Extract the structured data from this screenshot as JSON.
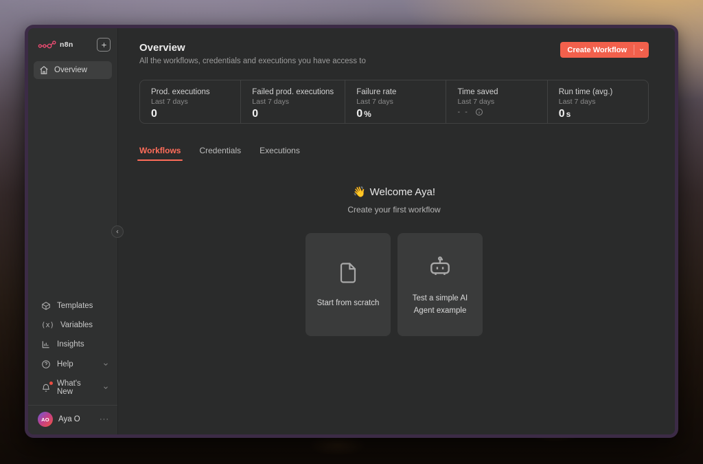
{
  "colors": {
    "accent": "#f2604c",
    "accent-light": "#ff6d5a",
    "logo": "#ea4b71",
    "badge": "#eb4d42"
  },
  "sidebar": {
    "logo_text": "n8n",
    "items": [
      {
        "label": "Overview",
        "icon": "home-icon"
      }
    ],
    "bottom_items": [
      {
        "label": "Templates",
        "icon": "package-icon"
      },
      {
        "label": "Variables",
        "icon": "variable-icon",
        "icon_glyph": "(x)"
      },
      {
        "label": "Insights",
        "icon": "bar-chart-icon"
      },
      {
        "label": "Help",
        "icon": "help-icon"
      },
      {
        "label": "What's New",
        "icon": "bell-icon"
      }
    ],
    "user": {
      "initials": "AO",
      "name": "Aya O",
      "menu_label": "···"
    }
  },
  "header": {
    "title": "Overview",
    "subtitle": "All the workflows, credentials and executions you have access to",
    "create_button_label": "Create Workflow"
  },
  "stats": {
    "cards": [
      {
        "label": "Prod. executions",
        "period": "Last 7 days",
        "value": "0",
        "unit": ""
      },
      {
        "label": "Failed prod. executions",
        "period": "Last 7 days",
        "value": "0",
        "unit": ""
      },
      {
        "label": "Failure rate",
        "period": "Last 7 days",
        "value": "0",
        "unit": "%"
      },
      {
        "label": "Time saved",
        "period": "Last 7 days",
        "value": "- -",
        "unit": ""
      },
      {
        "label": "Run time (avg.)",
        "period": "Last 7 days",
        "value": "0",
        "unit": "s"
      }
    ]
  },
  "tabs": [
    {
      "label": "Workflows",
      "active": true
    },
    {
      "label": "Credentials",
      "active": false
    },
    {
      "label": "Executions",
      "active": false
    }
  ],
  "empty_state": {
    "emoji": "👋",
    "title": "Welcome Aya!",
    "subtitle": "Create your first workflow",
    "cards": [
      {
        "label": "Start from scratch",
        "icon": "file-icon"
      },
      {
        "label": "Test a simple AI Agent example",
        "icon": "robot-icon"
      }
    ]
  }
}
